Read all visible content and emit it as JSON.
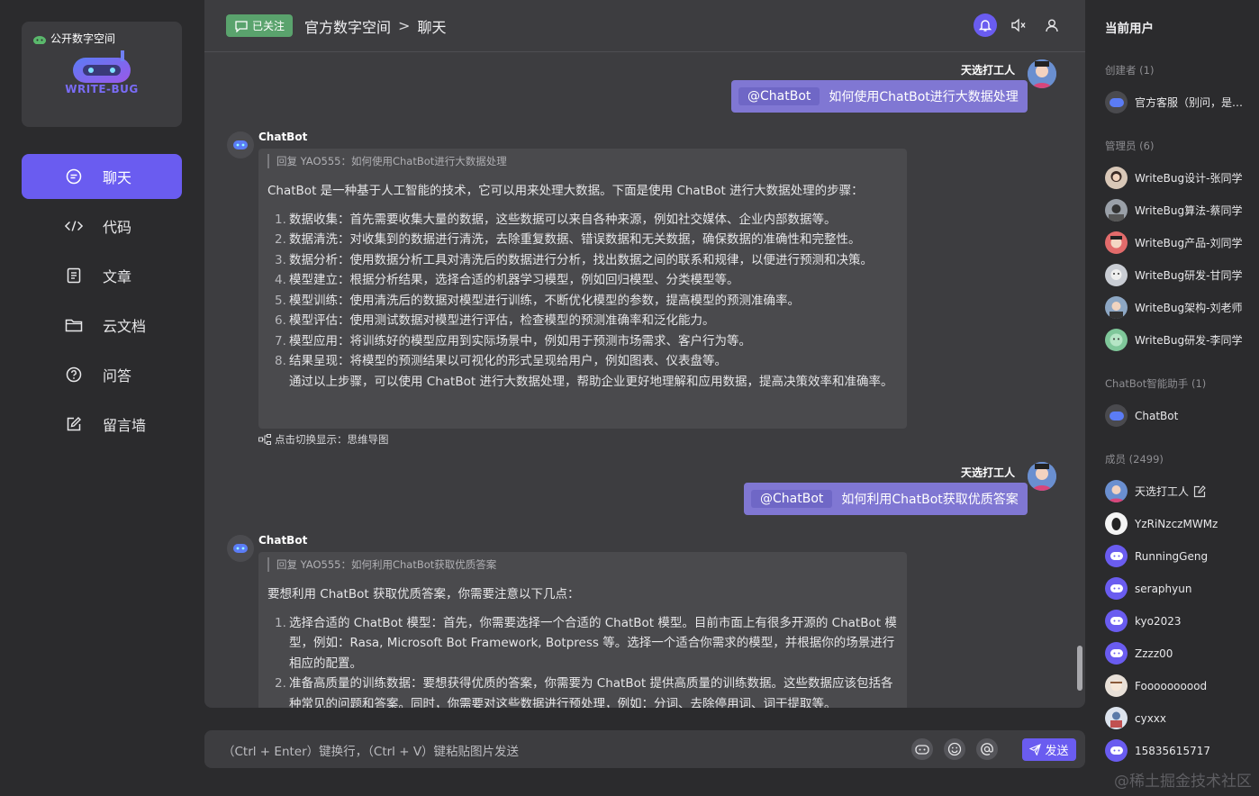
{
  "sidebar": {
    "logo_tag": "公开数字空间",
    "logo_text": "WRITE-BUG",
    "items": [
      {
        "label": "聊天",
        "icon": "chat-bubble-icon",
        "active": true
      },
      {
        "label": "代码",
        "icon": "code-icon",
        "active": false
      },
      {
        "label": "文章",
        "icon": "document-icon",
        "active": false
      },
      {
        "label": "云文档",
        "icon": "folder-icon",
        "active": false
      },
      {
        "label": "问答",
        "icon": "question-icon",
        "active": false
      },
      {
        "label": "留言墙",
        "icon": "edit-icon",
        "active": false
      }
    ]
  },
  "header": {
    "follow_label": "已关注",
    "space_name": "官方数字空间",
    "separator": ">",
    "page": "聊天"
  },
  "messages": [
    {
      "type": "user",
      "name": "天选打工人",
      "mention": "@ChatBot",
      "text": "如何使用ChatBot进行大数据处理"
    },
    {
      "type": "bot",
      "name": "ChatBot",
      "reply_ref": "回复 YAO555：如何使用ChatBot进行大数据处理",
      "lead": "ChatBot 是一种基于人工智能的技术，它可以用来处理大数据。下面是使用 ChatBot 进行大数据处理的步骤：",
      "items": [
        {
          "n": "1.",
          "text": "数据收集：首先需要收集大量的数据，这些数据可以来自各种来源，例如社交媒体、企业内部数据等。"
        },
        {
          "n": "2.",
          "text": "数据清洗：对收集到的数据进行清洗，去除重复数据、错误数据和无关数据，确保数据的准确性和完整性。"
        },
        {
          "n": "3.",
          "text": "数据分析：使用数据分析工具对清洗后的数据进行分析，找出数据之间的联系和规律，以便进行预测和决策。"
        },
        {
          "n": "4.",
          "text": "模型建立：根据分析结果，选择合适的机器学习模型，例如回归模型、分类模型等。"
        },
        {
          "n": "5.",
          "text": "模型训练：使用清洗后的数据对模型进行训练，不断优化模型的参数，提高模型的预测准确率。"
        },
        {
          "n": "6.",
          "text": "模型评估：使用测试数据对模型进行评估，检查模型的预测准确率和泛化能力。"
        },
        {
          "n": "7.",
          "text": "模型应用：将训练好的模型应用到实际场景中，例如用于预测市场需求、客户行为等。"
        },
        {
          "n": "8.",
          "text": "结果呈现：将模型的预测结果以可视化的形式呈现给用户，例如图表、仪表盘等。"
        }
      ],
      "tail": "通过以上步骤，可以使用 ChatBot 进行大数据处理，帮助企业更好地理解和应用数据，提高决策效率和准确率。",
      "switch_label": "点击切换显示：思维导图"
    },
    {
      "type": "user",
      "name": "天选打工人",
      "mention": "@ChatBot",
      "text": "如何利用ChatBot获取优质答案"
    },
    {
      "type": "bot",
      "name": "ChatBot",
      "reply_ref": "回复 YAO555：如何利用ChatBot获取优质答案",
      "lead": "要想利用 ChatBot 获取优质答案，你需要注意以下几点：",
      "items": [
        {
          "n": "1.",
          "text": "选择合适的 ChatBot 模型：首先，你需要选择一个合适的 ChatBot 模型。目前市面上有很多开源的 ChatBot 模型，例如：Rasa, Microsoft Bot Framework, Botpress 等。选择一个适合你需求的模型，并根据你的场景进行相应的配置。"
        },
        {
          "n": "2.",
          "text": "准备高质量的训练数据：要想获得优质的答案，你需要为 ChatBot 提供高质量的训练数据。这些数据应该包括各种常见的问题和答案。同时，你需要对这些数据进行预处理，例如：分词、去除停用词、词干提取等。"
        }
      ]
    }
  ],
  "input": {
    "placeholder": "（Ctrl + Enter）键换行，（Ctrl + V）键粘贴图片发送",
    "send_label": "发送"
  },
  "right_panel": {
    "title": "当前用户",
    "sections": [
      {
        "label": "创建者 (1)",
        "users": [
          {
            "name": "官方客服（别问，是…",
            "avatar": "bot-avatar"
          }
        ]
      },
      {
        "label": "管理员 (6)",
        "users": [
          {
            "name": "WriteBug设计-张同学",
            "avatar": "photo-avatar"
          },
          {
            "name": "WriteBug算法-蔡同学",
            "avatar": "photo-avatar"
          },
          {
            "name": "WriteBug产品-刘同学",
            "avatar": "photo-avatar"
          },
          {
            "name": "WriteBug研发-甘同学",
            "avatar": "photo-avatar"
          },
          {
            "name": "WriteBug架构-刘老师",
            "avatar": "photo-avatar"
          },
          {
            "name": "WriteBug研发-李同学",
            "avatar": "photo-avatar"
          }
        ]
      },
      {
        "label": "ChatBot智能助手 (1)",
        "users": [
          {
            "name": "ChatBot",
            "avatar": "bot-avatar"
          }
        ]
      },
      {
        "label": "成员 (2499)",
        "users": [
          {
            "name": "天选打工人",
            "avatar": "photo-avatar",
            "editable": true
          },
          {
            "name": "YzRiNzczMWMz",
            "avatar": "photo-avatar"
          },
          {
            "name": "RunningGeng",
            "avatar": "default-avatar"
          },
          {
            "name": "seraphyun",
            "avatar": "default-avatar"
          },
          {
            "name": "kyo2023",
            "avatar": "default-avatar"
          },
          {
            "name": "Zzzz00",
            "avatar": "default-avatar"
          },
          {
            "name": "Foooooooood",
            "avatar": "photo-avatar"
          },
          {
            "name": "cyxxx",
            "avatar": "photo-avatar"
          },
          {
            "name": "15835615717",
            "avatar": "default-avatar"
          }
        ]
      }
    ]
  },
  "watermark": "@稀土掘金技术社区",
  "colors": {
    "accent": "#6a5cf0",
    "follow": "#5aa36d",
    "user_bubble": "#8077d3"
  }
}
